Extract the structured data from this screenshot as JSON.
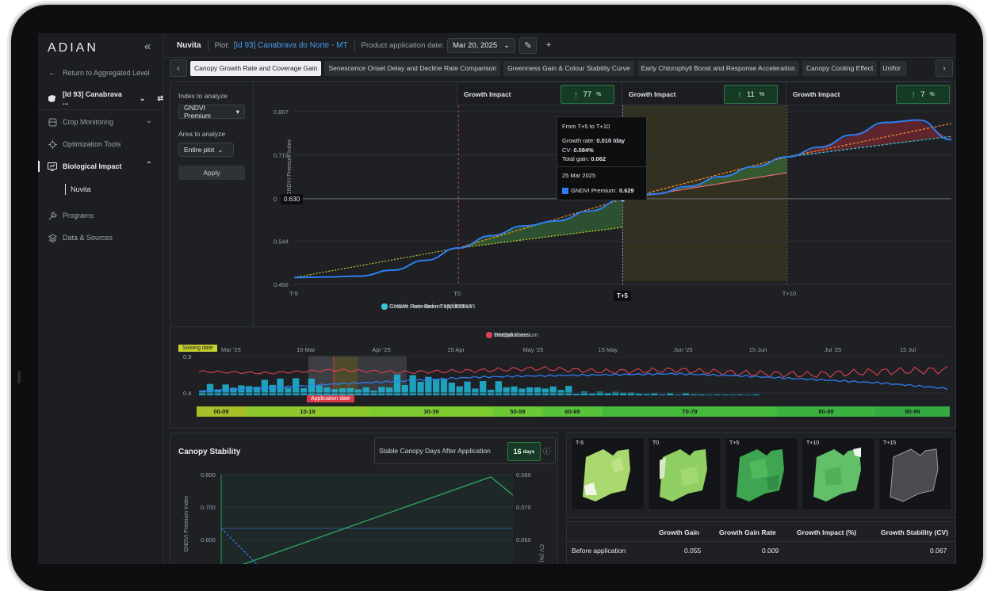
{
  "sidebar": {
    "logo": "ADIAN",
    "collapse_icon": "«",
    "return": "Return to Aggregated Level",
    "plot_selector": "[Id 93] Canabrava ...",
    "items": [
      {
        "label": "Crop Monitoring",
        "icon": "grid-icon"
      },
      {
        "label": "Optimization Tools",
        "icon": "crosshair-icon"
      },
      {
        "label": "Biological Impact",
        "icon": "monitor-chart-icon"
      },
      {
        "label": "Programs",
        "icon": "wrench-icon"
      },
      {
        "label": "Data & Sources",
        "icon": "layers-icon"
      }
    ],
    "subitem": "Nuvita"
  },
  "topbar": {
    "brand": "Nuvita",
    "plot_label": "Plot:",
    "plot_value": "[Id 93] Canabrava do Norte - MT",
    "date_label": "Product application date:",
    "date_value": "Mar 20, 2025",
    "add_icon": "+",
    "edit_icon": "✎"
  },
  "tabs": [
    "Canopy Growth Rate and Coverage Gain",
    "Senescence Onset Delay and Decline Rate Comparison",
    "Greenness Gain & Colour Stability Curve",
    "Early Chlorophyll Boost and Response Acceleration",
    "Canopy Cooling Effect",
    "Unifor"
  ],
  "controls": {
    "index_label": "Index to analyze",
    "index_value": "GNDVI Premium",
    "area_label": "Area to analyze",
    "area_value": "Entire plot",
    "apply": "Apply"
  },
  "growth_impacts": [
    {
      "label": "Growth Impact",
      "value": "77",
      "unit": "%"
    },
    {
      "label": "Growth Impact",
      "value": "11",
      "unit": "%"
    },
    {
      "label": "Growth Impact",
      "value": "7",
      "unit": "%"
    }
  ],
  "tooltip": {
    "title": "From T+5 to T+10",
    "growth_rate_label": "Growth rate:",
    "growth_rate": "0.010 /day",
    "cv_label": "CV:",
    "cv": "0.084%",
    "total_gain_label": "Total gain:",
    "total_gain": "0.062",
    "date": "25 Mar 2025",
    "series_label": "GNDVI Premium:",
    "series_value": "0.629"
  },
  "crosshair_value": "0.630",
  "crosshair_x_label": "T+5",
  "chart_data": [
    {
      "type": "line",
      "ylabel": "GNDVI Premium Index",
      "ylim": [
        0.456,
        0.807
      ],
      "y_ticks": [
        "0.807",
        "0.719",
        "0",
        "0.544",
        "0.456"
      ],
      "x_ticks": [
        "T-5",
        "T0",
        "T+5",
        "T+10"
      ],
      "x": [
        -5,
        -4,
        -3,
        -2,
        -1,
        0,
        1,
        2,
        3,
        4,
        5,
        6,
        7,
        8,
        9,
        10,
        11,
        12,
        13,
        14,
        15
      ],
      "series": [
        {
          "name": "GNDVI Premium",
          "color": "#2f7ef0",
          "values": [
            0.47,
            0.471,
            0.473,
            0.485,
            0.505,
            0.53,
            0.555,
            0.575,
            0.585,
            0.605,
            0.629,
            0.64,
            0.655,
            0.675,
            0.695,
            0.715,
            0.735,
            0.76,
            0.785,
            0.79,
            0.75
          ]
        },
        {
          "name": "Growth Rate Before application",
          "color": "#c8d030",
          "values": [
            0.47,
            null,
            null,
            null,
            null,
            0.53,
            null,
            null,
            null,
            null,
            0.572
          ]
        },
        {
          "name": "Growth Rate From T0 to T+5",
          "color": "#f0902a",
          "values": [
            null,
            null,
            null,
            null,
            null,
            0.53,
            null,
            null,
            null,
            null,
            0.629,
            null,
            null,
            null,
            null,
            0.715,
            null,
            null,
            null,
            null,
            0.783
          ]
        },
        {
          "name": "Growth Rate From T+5 to T+10",
          "color": "#e86a7a",
          "values": [
            null,
            null,
            null,
            null,
            null,
            null,
            null,
            null,
            null,
            null,
            0.629,
            null,
            null,
            null,
            null,
            0.683
          ]
        },
        {
          "name": "Growth Rate From T+10 to T+15",
          "color": "#2ec8e0",
          "values": [
            null,
            null,
            null,
            null,
            null,
            null,
            null,
            null,
            null,
            null,
            null,
            null,
            null,
            null,
            null,
            0.715,
            null,
            null,
            null,
            null,
            0.757
          ]
        }
      ]
    },
    {
      "type": "line",
      "x_ticks": [
        "Mar '25",
        "15 Mar",
        "Apr '25",
        "15 Apr",
        "May '25",
        "15 May",
        "Jun '25",
        "15 Jun",
        "Jul '25",
        "15 Jul"
      ],
      "y_ticks": [
        "0.9",
        "0.4"
      ],
      "series": [
        {
          "name": "GNDVI Premium",
          "color": "#2f7ef0",
          "values": [
            0.45,
            0.5,
            0.55,
            0.58,
            0.62,
            0.64,
            0.66,
            0.68,
            0.65,
            0.6,
            0.55,
            0.48
          ]
        },
        {
          "name": "Precipitations",
          "color": "#1fb8d8",
          "values": [
            12,
            18,
            9,
            22,
            15,
            10,
            4,
            2,
            1,
            0,
            0,
            0
          ]
        },
        {
          "name": "Temperature",
          "color": "#e0404e",
          "values": [
            0.7,
            0.68,
            0.72,
            0.69,
            0.71,
            0.74,
            0.7,
            0.72,
            0.68,
            0.66,
            0.7,
            0.72
          ]
        }
      ]
    },
    {
      "type": "line",
      "title": "Canopy Stability",
      "ylabel": "GNDVI Premium Index",
      "y_ticks": [
        "0.800",
        "0.700",
        "0.600"
      ],
      "y2label": "CV (%)",
      "y2_ticks": [
        "0.080",
        "0.070",
        "0.060"
      ]
    }
  ],
  "timeline": {
    "sowing_label": "Sowing date",
    "application_label": "Application date",
    "stages": [
      "00-09",
      "10-19",
      "30-39",
      "50-59",
      "60-69",
      "70-79",
      "80-89",
      "90-99"
    ]
  },
  "stability": {
    "title": "Canopy Stability",
    "stable_label": "Stable Canopy Days After Application",
    "stable_value": "16",
    "stable_unit": "days",
    "info_icon": "ⓘ"
  },
  "thumbnails": [
    "T-5",
    "T0",
    "T+5",
    "T+10",
    "T+15"
  ],
  "table": {
    "headers": [
      "Growth Gain",
      "Growth Gain Rate",
      "Growth Impact (%)",
      "Growth Stability (CV)"
    ],
    "rows": [
      {
        "label": "Before application",
        "values": [
          "0.055",
          "0.009",
          "",
          "0.067"
        ]
      }
    ]
  },
  "colors": {
    "background": "#1c1e22",
    "accent_blue": "#2f7ef0",
    "impact_green": "#3fd07a",
    "link": "#4a9ae8"
  }
}
